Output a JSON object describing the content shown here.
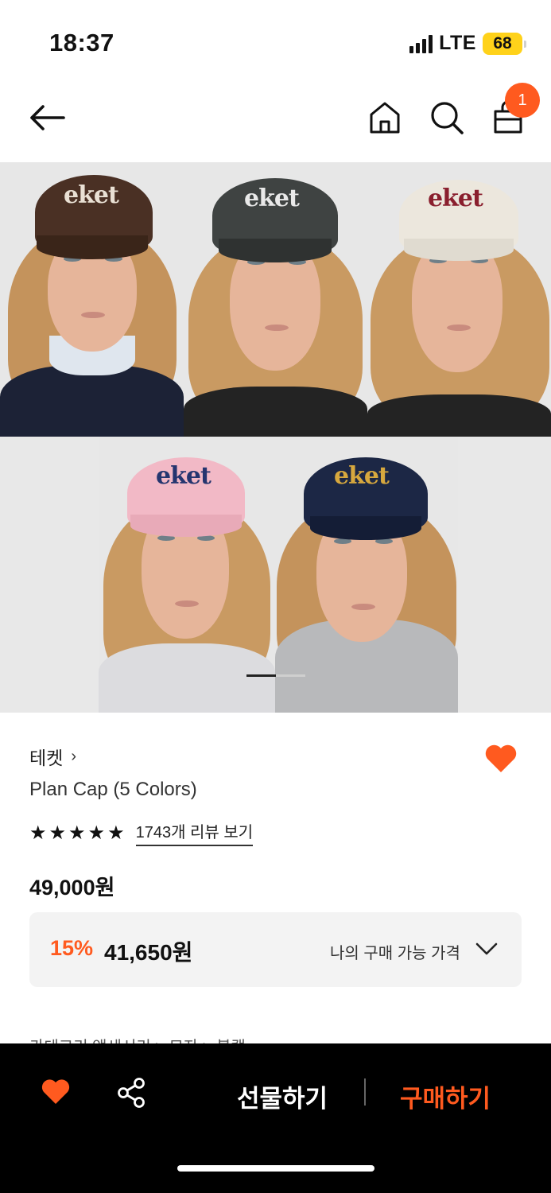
{
  "status_bar": {
    "time": "18:37",
    "network": "LTE",
    "battery": "68"
  },
  "top_nav": {
    "back_icon": "arrow-left-icon",
    "home_icon": "home-icon",
    "search_icon": "search-icon",
    "cart_icon": "shopping-bag-icon",
    "cart_count": "1"
  },
  "gallery": {
    "brand_logo": "eket",
    "cap_colors": [
      "#4a3024",
      "#3f4342",
      "#ece7dd",
      "#f2b9c6",
      "#1c2745"
    ],
    "logo_colors": [
      "#e9e0d4",
      "#e9e9e9",
      "#8a1f2e",
      "#25356f",
      "#d7a83e"
    ],
    "pages_total": 2,
    "current_page": 1
  },
  "product": {
    "brand": "테켓",
    "name": "Plan Cap (5 Colors)",
    "rating": 5,
    "review_link": "1743개 리뷰 보기",
    "original_price": "49,000원",
    "discount_rate": "15%",
    "sale_price": "41,650원",
    "my_price_label": "나의 구매 가능 가격",
    "wishlisted": true
  },
  "category": {
    "partial_text": "카테고리 액세서리 > 모자 > 볼캡"
  },
  "bottom_bar": {
    "gift_label": "선물하기",
    "buy_label": "구매하기"
  },
  "colors": {
    "accent": "#ff5a1f",
    "bottom_bar_bg": "#000000"
  }
}
